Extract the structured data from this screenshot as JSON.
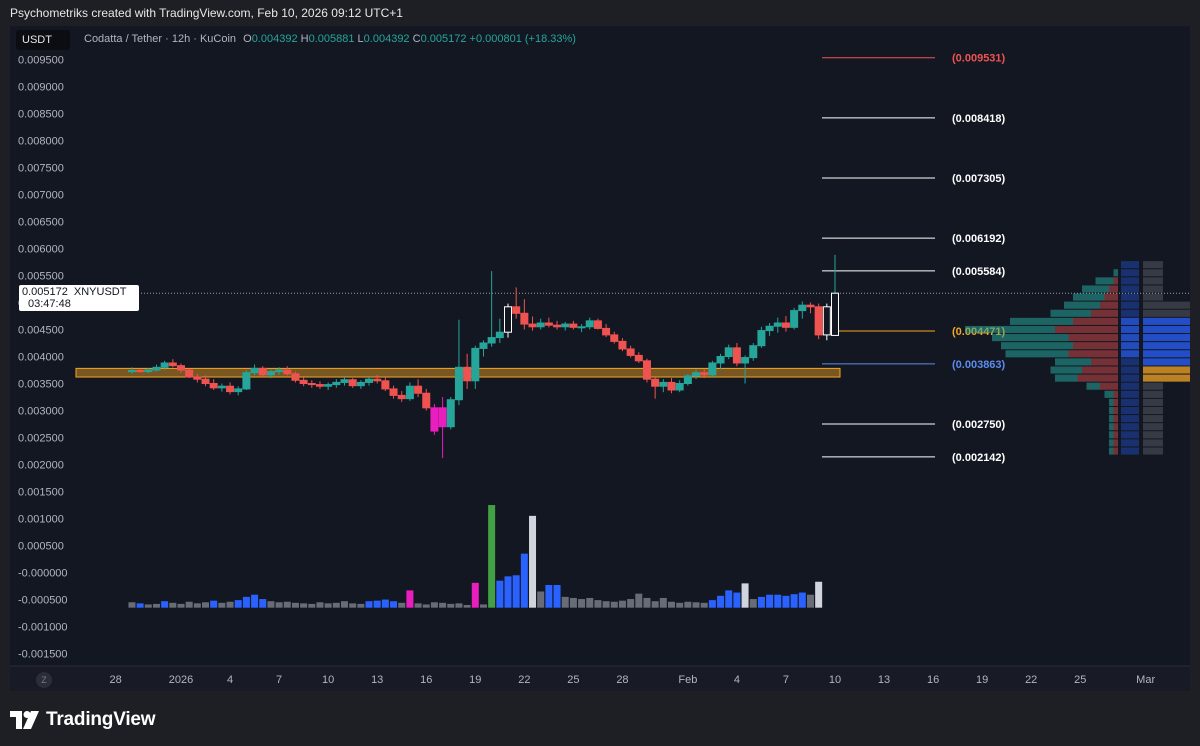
{
  "caption": "Psychometriks created with TradingView.com, Feb 10, 2026 09:12 UTC+1",
  "symbol_box": "USDT",
  "legend": {
    "name": "Codatta / Tether · 12h · KuCoin",
    "o_label": "O",
    "o": "0.004392",
    "h_label": "H",
    "h": "0.005881",
    "l_label": "L",
    "l": "0.004392",
    "c_label": "C",
    "c": "0.005172",
    "change": "+0.000801 (+18.33%)"
  },
  "price_tag": {
    "price": "0.005172",
    "symbol": "XNYUSDT",
    "countdown": "03:47:48"
  },
  "footer": {
    "brand": "TradingView",
    "timezone_button": "Z"
  },
  "colors": {
    "background": "#131722",
    "up": "#26a69a",
    "down": "#ef5350",
    "zone": "#f5a623",
    "text": "#b2b5be"
  },
  "chart_data": {
    "type": "candlestick",
    "interval": "12h",
    "yticks": [
      "0.009500",
      "0.009000",
      "0.008500",
      "0.008000",
      "0.007500",
      "0.007000",
      "0.006500",
      "0.006000",
      "0.005500",
      "0.005000",
      "0.004500",
      "0.004000",
      "0.003500",
      "0.003000",
      "0.002500",
      "0.002000",
      "0.001500",
      "0.001000",
      "0.000500",
      "-0.000000",
      "-0.000500",
      "-0.001000",
      "-0.001500"
    ],
    "ylim": [
      -0.0016,
      0.0096
    ],
    "x_labels": [
      {
        "label": "28",
        "day": -4
      },
      {
        "label": "2026",
        "day": 0
      },
      {
        "label": "4",
        "day": 3
      },
      {
        "label": "7",
        "day": 6
      },
      {
        "label": "10",
        "day": 9
      },
      {
        "label": "13",
        "day": 12
      },
      {
        "label": "16",
        "day": 15
      },
      {
        "label": "19",
        "day": 18
      },
      {
        "label": "22",
        "day": 21
      },
      {
        "label": "25",
        "day": 24
      },
      {
        "label": "28",
        "day": 27
      },
      {
        "label": "Feb",
        "day": 31
      },
      {
        "label": "4",
        "day": 34
      },
      {
        "label": "7",
        "day": 37
      },
      {
        "label": "10",
        "day": 40
      },
      {
        "label": "13",
        "day": 43
      },
      {
        "label": "16",
        "day": 46
      },
      {
        "label": "19",
        "day": 49
      },
      {
        "label": "22",
        "day": 52
      },
      {
        "label": "25",
        "day": 55
      },
      {
        "label": "Mar",
        "day": 59
      }
    ],
    "current_price": 0.005172,
    "levels": [
      {
        "value": 0.009531,
        "label": "(0.009531)",
        "color": "#ef5350"
      },
      {
        "value": 0.008418,
        "label": "(0.008418)",
        "color": "#ffffff"
      },
      {
        "value": 0.007305,
        "label": "(0.007305)",
        "color": "#ffffff"
      },
      {
        "value": 0.006192,
        "label": "(0.006192)",
        "color": "#ffffff"
      },
      {
        "value": 0.005584,
        "label": "(0.005584)",
        "color": "#ffffff"
      },
      {
        "value": 0.004471,
        "label": "(0.004471)",
        "color": "#f5a623"
      },
      {
        "value": 0.003863,
        "label": "(0.003863)",
        "color": "#5b8def"
      },
      {
        "value": 0.00275,
        "label": "(0.002750)",
        "color": "#ffffff"
      },
      {
        "value": 0.002142,
        "label": "(0.002142)",
        "color": "#ffffff"
      }
    ],
    "zone": {
      "low": 0.00362,
      "high": 0.00378
    },
    "candles": [
      {
        "o": 0.00372,
        "h": 0.0038,
        "l": 0.00368,
        "c": 0.00374
      },
      {
        "o": 0.00374,
        "h": 0.00378,
        "l": 0.0037,
        "c": 0.00372
      },
      {
        "o": 0.00372,
        "h": 0.00379,
        "l": 0.00369,
        "c": 0.00375
      },
      {
        "o": 0.00375,
        "h": 0.00385,
        "l": 0.00372,
        "c": 0.0038
      },
      {
        "o": 0.0038,
        "h": 0.00392,
        "l": 0.00375,
        "c": 0.00388
      },
      {
        "o": 0.00388,
        "h": 0.00395,
        "l": 0.0038,
        "c": 0.00383
      },
      {
        "o": 0.00383,
        "h": 0.00387,
        "l": 0.0037,
        "c": 0.00375
      },
      {
        "o": 0.00375,
        "h": 0.00378,
        "l": 0.0036,
        "c": 0.00362
      },
      {
        "o": 0.00362,
        "h": 0.00368,
        "l": 0.00352,
        "c": 0.00358
      },
      {
        "o": 0.00358,
        "h": 0.00365,
        "l": 0.00345,
        "c": 0.0035
      },
      {
        "o": 0.0035,
        "h": 0.00358,
        "l": 0.00338,
        "c": 0.00342
      },
      {
        "o": 0.00342,
        "h": 0.0035,
        "l": 0.00335,
        "c": 0.00345
      },
      {
        "o": 0.00345,
        "h": 0.00352,
        "l": 0.0033,
        "c": 0.00335
      },
      {
        "o": 0.00335,
        "h": 0.00345,
        "l": 0.00328,
        "c": 0.0034
      },
      {
        "o": 0.0034,
        "h": 0.00375,
        "l": 0.00338,
        "c": 0.0037
      },
      {
        "o": 0.0037,
        "h": 0.00385,
        "l": 0.00365,
        "c": 0.00378
      },
      {
        "o": 0.00378,
        "h": 0.00382,
        "l": 0.00362,
        "c": 0.00366
      },
      {
        "o": 0.00366,
        "h": 0.00376,
        "l": 0.0036,
        "c": 0.00372
      },
      {
        "o": 0.00372,
        "h": 0.0038,
        "l": 0.00366,
        "c": 0.00375
      },
      {
        "o": 0.00375,
        "h": 0.00382,
        "l": 0.00365,
        "c": 0.00368
      },
      {
        "o": 0.00368,
        "h": 0.00372,
        "l": 0.00352,
        "c": 0.00356
      },
      {
        "o": 0.00356,
        "h": 0.00362,
        "l": 0.00345,
        "c": 0.0035
      },
      {
        "o": 0.0035,
        "h": 0.00356,
        "l": 0.00342,
        "c": 0.00348
      },
      {
        "o": 0.00348,
        "h": 0.00354,
        "l": 0.0034,
        "c": 0.00345
      },
      {
        "o": 0.00345,
        "h": 0.00352,
        "l": 0.00338,
        "c": 0.00348
      },
      {
        "o": 0.00348,
        "h": 0.00358,
        "l": 0.00342,
        "c": 0.00352
      },
      {
        "o": 0.00352,
        "h": 0.00362,
        "l": 0.00346,
        "c": 0.00357
      },
      {
        "o": 0.00357,
        "h": 0.0036,
        "l": 0.00342,
        "c": 0.00346
      },
      {
        "o": 0.00346,
        "h": 0.00356,
        "l": 0.0034,
        "c": 0.00352
      },
      {
        "o": 0.00352,
        "h": 0.00362,
        "l": 0.00346,
        "c": 0.00358
      },
      {
        "o": 0.00358,
        "h": 0.00366,
        "l": 0.0035,
        "c": 0.00355
      },
      {
        "o": 0.00355,
        "h": 0.00362,
        "l": 0.00336,
        "c": 0.0034
      },
      {
        "o": 0.0034,
        "h": 0.00346,
        "l": 0.00322,
        "c": 0.00328
      },
      {
        "o": 0.00328,
        "h": 0.00336,
        "l": 0.00316,
        "c": 0.00322
      },
      {
        "o": 0.00322,
        "h": 0.00352,
        "l": 0.00318,
        "c": 0.00345
      },
      {
        "o": 0.00345,
        "h": 0.00358,
        "l": 0.00325,
        "c": 0.00332
      },
      {
        "o": 0.00332,
        "h": 0.0034,
        "l": 0.003,
        "c": 0.00305
      },
      {
        "o": 0.00305,
        "h": 0.00312,
        "l": 0.00255,
        "c": 0.00262
      },
      {
        "o": 0.00305,
        "h": 0.00325,
        "l": 0.00212,
        "c": 0.0027
      },
      {
        "o": 0.0027,
        "h": 0.00325,
        "l": 0.00265,
        "c": 0.0032
      },
      {
        "o": 0.0032,
        "h": 0.00468,
        "l": 0.0031,
        "c": 0.0038
      },
      {
        "o": 0.0038,
        "h": 0.00405,
        "l": 0.0034,
        "c": 0.00355
      },
      {
        "o": 0.00355,
        "h": 0.0042,
        "l": 0.0034,
        "c": 0.00415
      },
      {
        "o": 0.00415,
        "h": 0.0043,
        "l": 0.004,
        "c": 0.00425
      },
      {
        "o": 0.00425,
        "h": 0.00558,
        "l": 0.00418,
        "c": 0.00435
      },
      {
        "o": 0.00435,
        "h": 0.0047,
        "l": 0.00425,
        "c": 0.00445
      },
      {
        "o": 0.00445,
        "h": 0.00498,
        "l": 0.00435,
        "c": 0.00492
      },
      {
        "o": 0.00492,
        "h": 0.00528,
        "l": 0.0047,
        "c": 0.0048
      },
      {
        "o": 0.0048,
        "h": 0.00506,
        "l": 0.0045,
        "c": 0.0046
      },
      {
        "o": 0.0046,
        "h": 0.00474,
        "l": 0.00448,
        "c": 0.00455
      },
      {
        "o": 0.00455,
        "h": 0.0047,
        "l": 0.0045,
        "c": 0.00462
      },
      {
        "o": 0.00462,
        "h": 0.00472,
        "l": 0.00454,
        "c": 0.00458
      },
      {
        "o": 0.00458,
        "h": 0.00466,
        "l": 0.0045,
        "c": 0.00455
      },
      {
        "o": 0.00455,
        "h": 0.00464,
        "l": 0.00448,
        "c": 0.0046
      },
      {
        "o": 0.0046,
        "h": 0.00466,
        "l": 0.0045,
        "c": 0.00454
      },
      {
        "o": 0.00454,
        "h": 0.0046,
        "l": 0.00445,
        "c": 0.00455
      },
      {
        "o": 0.00455,
        "h": 0.00472,
        "l": 0.0045,
        "c": 0.00466
      },
      {
        "o": 0.00466,
        "h": 0.0047,
        "l": 0.0045,
        "c": 0.00452
      },
      {
        "o": 0.00452,
        "h": 0.0046,
        "l": 0.00436,
        "c": 0.0044
      },
      {
        "o": 0.0044,
        "h": 0.00446,
        "l": 0.00424,
        "c": 0.00428
      },
      {
        "o": 0.00428,
        "h": 0.00434,
        "l": 0.0041,
        "c": 0.00414
      },
      {
        "o": 0.00414,
        "h": 0.0042,
        "l": 0.00398,
        "c": 0.00402
      },
      {
        "o": 0.00402,
        "h": 0.00408,
        "l": 0.00388,
        "c": 0.00392
      },
      {
        "o": 0.00392,
        "h": 0.00396,
        "l": 0.00352,
        "c": 0.00358
      },
      {
        "o": 0.00358,
        "h": 0.00364,
        "l": 0.00322,
        "c": 0.00345
      },
      {
        "o": 0.00345,
        "h": 0.00358,
        "l": 0.00334,
        "c": 0.00352
      },
      {
        "o": 0.00352,
        "h": 0.0036,
        "l": 0.00332,
        "c": 0.00338
      },
      {
        "o": 0.00338,
        "h": 0.00356,
        "l": 0.00334,
        "c": 0.0035
      },
      {
        "o": 0.0035,
        "h": 0.00368,
        "l": 0.00346,
        "c": 0.00364
      },
      {
        "o": 0.00364,
        "h": 0.00376,
        "l": 0.00358,
        "c": 0.0037
      },
      {
        "o": 0.0037,
        "h": 0.00378,
        "l": 0.0036,
        "c": 0.00366
      },
      {
        "o": 0.00366,
        "h": 0.00392,
        "l": 0.00362,
        "c": 0.00388
      },
      {
        "o": 0.00388,
        "h": 0.00405,
        "l": 0.00376,
        "c": 0.004
      },
      {
        "o": 0.004,
        "h": 0.00422,
        "l": 0.00395,
        "c": 0.00416
      },
      {
        "o": 0.00416,
        "h": 0.00425,
        "l": 0.00382,
        "c": 0.00388
      },
      {
        "o": 0.00388,
        "h": 0.00402,
        "l": 0.0035,
        "c": 0.00398
      },
      {
        "o": 0.00398,
        "h": 0.00425,
        "l": 0.00392,
        "c": 0.0042
      },
      {
        "o": 0.0042,
        "h": 0.00455,
        "l": 0.00416,
        "c": 0.00448
      },
      {
        "o": 0.00448,
        "h": 0.00462,
        "l": 0.00438,
        "c": 0.00456
      },
      {
        "o": 0.00456,
        "h": 0.00472,
        "l": 0.00444,
        "c": 0.00462
      },
      {
        "o": 0.00462,
        "h": 0.00475,
        "l": 0.00446,
        "c": 0.00454
      },
      {
        "o": 0.00454,
        "h": 0.0049,
        "l": 0.0045,
        "c": 0.00485
      },
      {
        "o": 0.00485,
        "h": 0.00502,
        "l": 0.0047,
        "c": 0.00495
      },
      {
        "o": 0.00495,
        "h": 0.005,
        "l": 0.0048,
        "c": 0.00492
      },
      {
        "o": 0.00492,
        "h": 0.00498,
        "l": 0.00432,
        "c": 0.0044
      },
      {
        "o": 0.0044,
        "h": 0.00498,
        "l": 0.0043,
        "c": 0.00492
      },
      {
        "o": 0.00439,
        "h": 0.005881,
        "l": 0.00439,
        "c": 0.005172
      }
    ],
    "volume_ylim": [
      -0.0016,
      0.0096
    ],
    "volume_base": -0.00065,
    "volume": [
      {
        "v": 0.0001,
        "c": "#787b86"
      },
      {
        "v": 8e-05,
        "c": "#2962ff"
      },
      {
        "v": 6e-05,
        "c": "#787b86"
      },
      {
        "v": 7e-05,
        "c": "#787b86"
      },
      {
        "v": 0.00012,
        "c": "#2962ff"
      },
      {
        "v": 9e-05,
        "c": "#787b86"
      },
      {
        "v": 7e-05,
        "c": "#787b86"
      },
      {
        "v": 0.00011,
        "c": "#787b86"
      },
      {
        "v": 8e-05,
        "c": "#787b86"
      },
      {
        "v": 0.0001,
        "c": "#787b86"
      },
      {
        "v": 0.00013,
        "c": "#2962ff"
      },
      {
        "v": 9e-05,
        "c": "#787b86"
      },
      {
        "v": 0.00011,
        "c": "#787b86"
      },
      {
        "v": 0.00014,
        "c": "#2962ff"
      },
      {
        "v": 0.0002,
        "c": "#2962ff"
      },
      {
        "v": 0.00024,
        "c": "#2962ff"
      },
      {
        "v": 0.00016,
        "c": "#2962ff"
      },
      {
        "v": 0.00012,
        "c": "#787b86"
      },
      {
        "v": 0.0001,
        "c": "#787b86"
      },
      {
        "v": 0.00011,
        "c": "#787b86"
      },
      {
        "v": 9e-05,
        "c": "#787b86"
      },
      {
        "v": 8e-05,
        "c": "#787b86"
      },
      {
        "v": 7e-05,
        "c": "#787b86"
      },
      {
        "v": 0.0001,
        "c": "#787b86"
      },
      {
        "v": 8e-05,
        "c": "#787b86"
      },
      {
        "v": 9e-05,
        "c": "#787b86"
      },
      {
        "v": 0.00012,
        "c": "#787b86"
      },
      {
        "v": 8e-05,
        "c": "#787b86"
      },
      {
        "v": 7e-05,
        "c": "#787b86"
      },
      {
        "v": 0.00012,
        "c": "#2962ff"
      },
      {
        "v": 0.00013,
        "c": "#2962ff"
      },
      {
        "v": 0.00015,
        "c": "#2962ff"
      },
      {
        "v": 0.00012,
        "c": "#2962ff"
      },
      {
        "v": 9e-05,
        "c": "#787b86"
      },
      {
        "v": 0.00032,
        "c": "#e91ebf"
      },
      {
        "v": 8e-05,
        "c": "#787b86"
      },
      {
        "v": 6e-05,
        "c": "#787b86"
      },
      {
        "v": 0.0001,
        "c": "#787b86"
      },
      {
        "v": 9e-05,
        "c": "#787b86"
      },
      {
        "v": 7e-05,
        "c": "#787b86"
      },
      {
        "v": 8e-05,
        "c": "#787b86"
      },
      {
        "v": 5e-05,
        "c": "#787b86"
      },
      {
        "v": 0.00046,
        "c": "#e91ebf"
      },
      {
        "v": 6e-05,
        "c": "#787b86"
      },
      {
        "v": 0.0019,
        "c": "#43a047"
      },
      {
        "v": 0.0005,
        "c": "#2962ff"
      },
      {
        "v": 0.00058,
        "c": "#2962ff"
      },
      {
        "v": 0.0006,
        "c": "#2962ff"
      },
      {
        "v": 0.001,
        "c": "#2962ff"
      },
      {
        "v": 0.0017,
        "c": "#d1d4dc"
      },
      {
        "v": 0.0003,
        "c": "#787b86"
      },
      {
        "v": 0.00042,
        "c": "#2962ff"
      },
      {
        "v": 0.00042,
        "c": "#2962ff"
      },
      {
        "v": 0.0002,
        "c": "#787b86"
      },
      {
        "v": 0.00018,
        "c": "#787b86"
      },
      {
        "v": 0.00016,
        "c": "#787b86"
      },
      {
        "v": 0.00018,
        "c": "#787b86"
      },
      {
        "v": 0.00014,
        "c": "#787b86"
      },
      {
        "v": 0.00012,
        "c": "#787b86"
      },
      {
        "v": 0.00011,
        "c": "#787b86"
      },
      {
        "v": 0.00013,
        "c": "#787b86"
      },
      {
        "v": 0.00016,
        "c": "#787b86"
      },
      {
        "v": 0.00026,
        "c": "#787b86"
      },
      {
        "v": 0.00018,
        "c": "#787b86"
      },
      {
        "v": 0.00012,
        "c": "#787b86"
      },
      {
        "v": 0.00018,
        "c": "#787b86"
      },
      {
        "v": 0.00011,
        "c": "#787b86"
      },
      {
        "v": 9e-05,
        "c": "#787b86"
      },
      {
        "v": 0.00011,
        "c": "#787b86"
      },
      {
        "v": 0.0001,
        "c": "#787b86"
      },
      {
        "v": 9e-05,
        "c": "#787b86"
      },
      {
        "v": 0.00014,
        "c": "#2962ff"
      },
      {
        "v": 0.00022,
        "c": "#2962ff"
      },
      {
        "v": 0.00032,
        "c": "#2962ff"
      },
      {
        "v": 0.00028,
        "c": "#2962ff"
      },
      {
        "v": 0.00045,
        "c": "#d1d4dc"
      },
      {
        "v": 0.00016,
        "c": "#787b86"
      },
      {
        "v": 0.0002,
        "c": "#2962ff"
      },
      {
        "v": 0.00024,
        "c": "#2962ff"
      },
      {
        "v": 0.00024,
        "c": "#2962ff"
      },
      {
        "v": 0.00022,
        "c": "#2962ff"
      },
      {
        "v": 0.00025,
        "c": "#2962ff"
      },
      {
        "v": 0.00028,
        "c": "#2962ff"
      },
      {
        "v": 0.00024,
        "c": "#787b86"
      },
      {
        "v": 0.00048,
        "c": "#d1d4dc"
      }
    ],
    "volume_profile": [
      {
        "price": 0.0057,
        "up": 0.0,
        "down": 0.0
      },
      {
        "price": 0.00555,
        "up": 1e-05,
        "down": 0.0
      },
      {
        "price": 0.0054,
        "up": 4e-05,
        "down": 1e-05
      },
      {
        "price": 0.00525,
        "up": 6e-05,
        "down": 2e-05
      },
      {
        "price": 0.0051,
        "up": 7e-05,
        "down": 3e-05
      },
      {
        "price": 0.00495,
        "up": 8e-05,
        "down": 4e-05
      },
      {
        "price": 0.0048,
        "up": 9e-05,
        "down": 6e-05
      },
      {
        "price": 0.00465,
        "up": 0.00014,
        "down": 0.0001
      },
      {
        "price": 0.0045,
        "up": 0.0002,
        "down": 0.00014
      },
      {
        "price": 0.00435,
        "up": 0.00017,
        "down": 0.00011
      },
      {
        "price": 0.0042,
        "up": 0.00016,
        "down": 0.0001
      },
      {
        "price": 0.00405,
        "up": 0.00014,
        "down": 0.00011
      },
      {
        "price": 0.0039,
        "up": 8e-05,
        "down": 6e-05
      },
      {
        "price": 0.00375,
        "up": 7e-05,
        "down": 8e-05
      },
      {
        "price": 0.0036,
        "up": 5e-05,
        "down": 9e-05
      },
      {
        "price": 0.00345,
        "up": 3e-05,
        "down": 4e-05
      },
      {
        "price": 0.0033,
        "up": 2e-05,
        "down": 1e-05
      },
      {
        "price": 0.00315,
        "up": 1e-05,
        "down": 1e-05
      },
      {
        "price": 0.003,
        "up": 1e-05,
        "down": 1e-05
      },
      {
        "price": 0.00285,
        "up": 1e-05,
        "down": 1e-05
      },
      {
        "price": 0.0027,
        "up": 1e-05,
        "down": 1e-05
      },
      {
        "price": 0.00255,
        "up": 1e-05,
        "down": 1e-05
      },
      {
        "price": 0.0024,
        "up": 1e-05,
        "down": 1e-05
      },
      {
        "price": 0.00225,
        "up": 1e-05,
        "down": 1e-05
      }
    ]
  }
}
